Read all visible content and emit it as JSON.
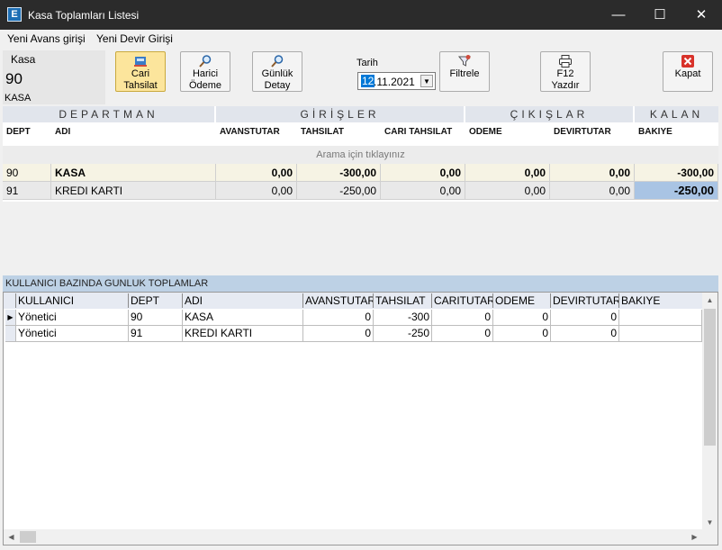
{
  "window": {
    "title": "Kasa Toplamları Listesi",
    "app_icon_letter": "E",
    "minimize": "—",
    "maximize": "☐",
    "close": "✕"
  },
  "menu": {
    "items": [
      "Yeni Avans girişi",
      "Yeni Devir Girişi"
    ]
  },
  "cash": {
    "label": "Kasa",
    "code": "90",
    "name": "KASA"
  },
  "toolbar": {
    "cari_tahsilat": {
      "line1": "Cari",
      "line2": "Tahsilat"
    },
    "harici_odeme": {
      "line1": "Harici",
      "line2": "Ödeme"
    },
    "gunluk_detay": {
      "line1": "Günlük",
      "line2": "Detay"
    },
    "date_label": "Tarih",
    "date_selected": "12",
    "date_rest": ".11.2021",
    "filtrele": "Filtrele",
    "yazdir": "F12 Yazdır",
    "kapat": "Kapat"
  },
  "top_grid": {
    "groups": [
      "DEPARTMAN",
      "GİRİŞLER",
      "ÇIKIŞLAR",
      "KALAN"
    ],
    "headers": [
      "DEPT",
      "ADI",
      "AVANSTUTAR",
      "TAHSILAT",
      "CARI TAHSILAT",
      "ODEME",
      "DEVIRTUTAR",
      "BAKIYE"
    ],
    "search_hint": "Arama için tıklayınız",
    "rows": [
      [
        "90",
        "KASA",
        "0,00",
        "-300,00",
        "0,00",
        "0,00",
        "0,00",
        "-300,00"
      ],
      [
        "91",
        "KREDI KARTI",
        "0,00",
        "-250,00",
        "0,00",
        "0,00",
        "0,00",
        "-250,00"
      ]
    ]
  },
  "bottom": {
    "section_title": "KULLANICI BAZINDA GUNLUK TOPLAMLAR",
    "headers": [
      "KULLANICI",
      "DEPT",
      "ADI",
      "AVANSTUTAR",
      "TAHSILAT",
      "CARITUTAR",
      "ODEME",
      "DEVIRTUTAR",
      "BAKIYE"
    ],
    "rows": [
      [
        "Yönetici",
        "90",
        "KASA",
        "0",
        "-300",
        "0",
        "0",
        "0",
        ""
      ],
      [
        "Yönetici",
        "91",
        "KREDI KARTI",
        "0",
        "-250",
        "0",
        "0",
        "0",
        ""
      ]
    ]
  }
}
